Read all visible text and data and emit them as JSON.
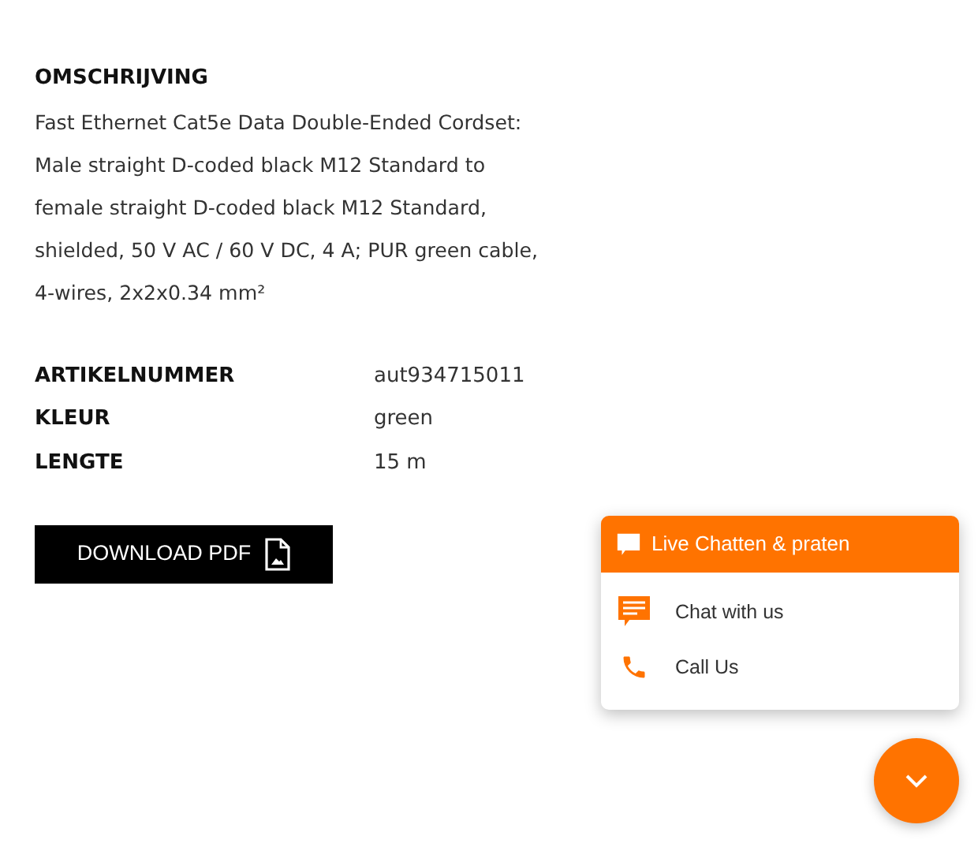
{
  "description": {
    "heading": "OMSCHRIJVING",
    "lines": [
      "Fast Ethernet Cat5e Data Double-Ended Cordset:",
      "Male straight D-coded black M12 Standard to",
      "female straight D-coded black M12 Standard,",
      "shielded, 50 V AC / 60 V DC, 4 A; PUR green cable,",
      "4-wires, 2x2x0.34 mm²"
    ]
  },
  "specs": [
    {
      "label": "ARTIKELNUMMER",
      "value": "aut934715011"
    },
    {
      "label": "KLEUR",
      "value": "green"
    },
    {
      "label": "LENGTE",
      "value": "15 m"
    }
  ],
  "download_button": "DOWNLOAD PDF",
  "chat_widget": {
    "title": "Live Chatten & praten",
    "expanded": true,
    "options": [
      {
        "kind": "chat",
        "label": "Chat with us"
      },
      {
        "kind": "call",
        "label": "Call Us"
      }
    ]
  }
}
